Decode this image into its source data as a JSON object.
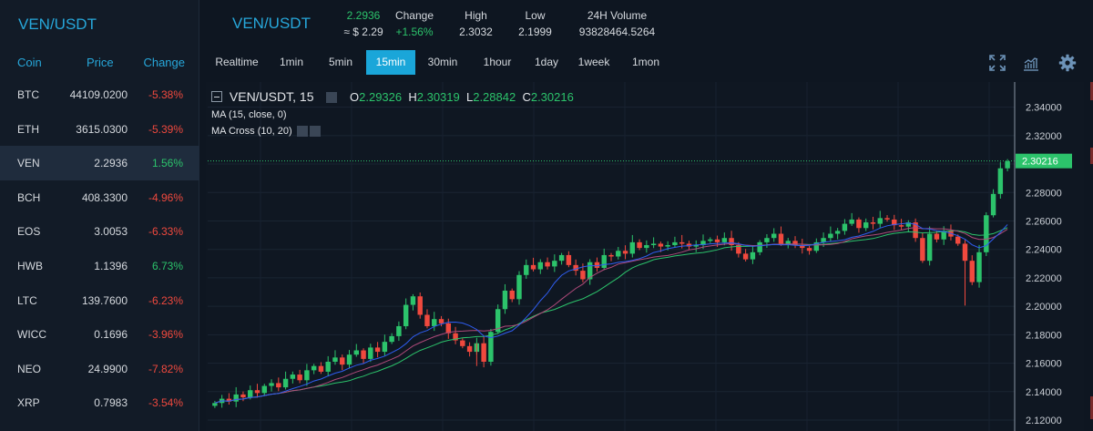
{
  "sidebar": {
    "title": "VEN/USDT",
    "headers": {
      "coin": "Coin",
      "price": "Price",
      "change": "Change"
    },
    "rows": [
      {
        "coin": "BTC",
        "price": "44109.0200",
        "change": "-5.38%",
        "dir": "neg"
      },
      {
        "coin": "ETH",
        "price": "3615.0300",
        "change": "-5.39%",
        "dir": "neg"
      },
      {
        "coin": "VEN",
        "price": "2.2936",
        "change": "1.56%",
        "dir": "pos",
        "active": true
      },
      {
        "coin": "BCH",
        "price": "408.3300",
        "change": "-4.96%",
        "dir": "neg"
      },
      {
        "coin": "EOS",
        "price": "3.0053",
        "change": "-6.33%",
        "dir": "neg"
      },
      {
        "coin": "HWB",
        "price": "1.1396",
        "change": "6.73%",
        "dir": "pos"
      },
      {
        "coin": "LTC",
        "price": "139.7600",
        "change": "-6.23%",
        "dir": "neg"
      },
      {
        "coin": "WICC",
        "price": "0.1696",
        "change": "-3.96%",
        "dir": "neg"
      },
      {
        "coin": "NEO",
        "price": "24.9900",
        "change": "-7.82%",
        "dir": "neg"
      },
      {
        "coin": "XRP",
        "price": "0.7983",
        "change": "-3.54%",
        "dir": "neg"
      }
    ]
  },
  "header": {
    "pair": "VEN/USDT",
    "price": "2.2936",
    "price_usd": "≈ $ 2.29",
    "change_label": "Change",
    "change_value": "+1.56%",
    "high_label": "High",
    "high_value": "2.3032",
    "low_label": "Low",
    "low_value": "2.1999",
    "volume_label": "24H Volume",
    "volume_value": "93828464.5264"
  },
  "toolbar": {
    "timeframes": [
      "Realtime",
      "1min",
      "5min",
      "15min",
      "30min",
      "1hour",
      "1day",
      "1week",
      "1mon"
    ],
    "active": "15min",
    "icons": [
      "fullscreen-icon",
      "indicators-icon",
      "settings-gear-icon"
    ]
  },
  "legend": {
    "symbol": "VEN/USDT, 15",
    "o_label": "O",
    "o_value": "2.29326",
    "h_label": "H",
    "h_value": "2.30319",
    "l_label": "L",
    "l_value": "2.28842",
    "c_label": "C",
    "c_value": "2.30216",
    "indicator_1": "MA (15, close, 0)",
    "indicator_2": "MA Cross (10, 20)"
  },
  "colors": {
    "up": "#2cc36b",
    "down": "#f0493e",
    "accent": "#1aa6d9",
    "ma15": "#b04a7a",
    "ma_cross_fast": "#2f5df0",
    "ma_cross_slow": "#2cc36b"
  },
  "chart_data": {
    "type": "candlestick",
    "ylim": [
      2.12,
      2.35
    ],
    "yticks": [
      "2.34000",
      "2.32000",
      "2.30000",
      "2.28000",
      "2.26000",
      "2.24000",
      "2.22000",
      "2.20000",
      "2.18000",
      "2.16000",
      "2.14000",
      "2.12000"
    ],
    "last_price_label": "2.30216",
    "last_price": 2.30216,
    "close": [
      2.132,
      2.135,
      2.133,
      2.138,
      2.136,
      2.141,
      2.139,
      2.144,
      2.146,
      2.143,
      2.149,
      2.152,
      2.148,
      2.155,
      2.158,
      2.154,
      2.161,
      2.164,
      2.159,
      2.166,
      2.169,
      2.163,
      2.171,
      2.168,
      2.175,
      2.179,
      2.186,
      2.201,
      2.207,
      2.194,
      2.186,
      2.191,
      2.188,
      2.181,
      2.176,
      2.172,
      2.168,
      2.174,
      2.161,
      2.182,
      2.198,
      2.211,
      2.205,
      2.222,
      2.229,
      2.226,
      2.231,
      2.228,
      2.232,
      2.236,
      2.229,
      2.225,
      2.219,
      2.231,
      2.227,
      2.236,
      2.235,
      2.239,
      2.237,
      2.245,
      2.241,
      2.243,
      2.244,
      2.242,
      2.243,
      2.245,
      2.244,
      2.242,
      2.243,
      2.246,
      2.247,
      2.245,
      2.248,
      2.243,
      2.237,
      2.233,
      2.238,
      2.245,
      2.248,
      2.251,
      2.244,
      2.246,
      2.243,
      2.241,
      2.239,
      2.245,
      2.248,
      2.251,
      2.253,
      2.258,
      2.261,
      2.255,
      2.259,
      2.258,
      2.262,
      2.261,
      2.257,
      2.256,
      2.259,
      2.248,
      2.232,
      2.251,
      2.247,
      2.253,
      2.249,
      2.244,
      2.232,
      2.217,
      2.238,
      2.264,
      2.279,
      2.297,
      2.302
    ]
  }
}
